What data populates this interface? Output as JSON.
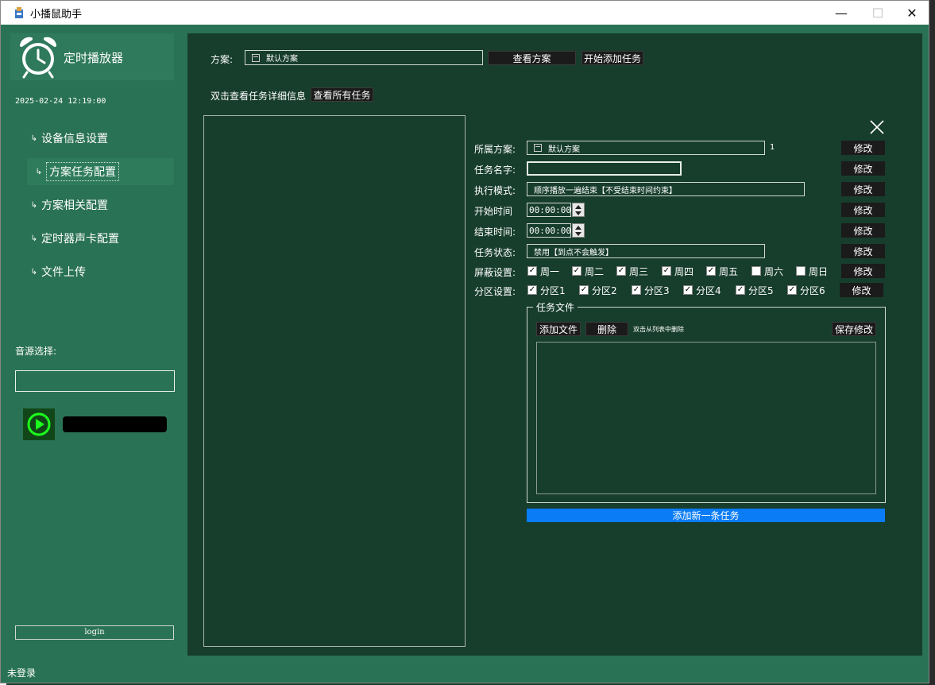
{
  "window": {
    "title": "小播鼠助手",
    "minimize": "—",
    "maximize": "☐",
    "close": "✕"
  },
  "sidebar": {
    "brand": "定时播放器",
    "datetime": "2025-02-24 12:19:00",
    "items": [
      {
        "label": "设备信息设置",
        "active": false
      },
      {
        "label": "方案任务配置",
        "active": true
      },
      {
        "label": "方案相关配置",
        "active": false
      },
      {
        "label": "定时器声卡配置",
        "active": false
      },
      {
        "label": "文件上传",
        "active": false
      }
    ],
    "audio_label": "音源选择:",
    "login": "login"
  },
  "status": "未登录",
  "header": {
    "plan_label": "方案:",
    "plan_value": "默认方案",
    "view_plan": "查看方案",
    "start_add": "开始添加任务",
    "hint": "双击查看任务详细信息",
    "view_all": "查看所有任务"
  },
  "detail": {
    "modify": "修改",
    "plan_label": "所属方案:",
    "plan_value": "默认方案",
    "plan_index": "1",
    "name_label": "任务名字:",
    "name_value": "",
    "mode_label": "执行模式:",
    "mode_value": "顺序播放一遍结束【不受结束时间约束】",
    "start_label": "开始时间",
    "start_value": "00:00:00",
    "end_label": "结束时间:",
    "end_value": "00:00:00",
    "state_label": "任务状态:",
    "state_value": "禁用【到点不会触发】",
    "block_label": "屏蔽设置:",
    "weekdays": [
      {
        "label": "周一",
        "checked": true
      },
      {
        "label": "周二",
        "checked": true
      },
      {
        "label": "周三",
        "checked": true
      },
      {
        "label": "周四",
        "checked": true
      },
      {
        "label": "周五",
        "checked": true
      },
      {
        "label": "周六",
        "checked": false
      },
      {
        "label": "周日",
        "checked": false
      }
    ],
    "zone_label": "分区设置:",
    "zones": [
      {
        "label": "分区1",
        "checked": true
      },
      {
        "label": "分区2",
        "checked": true
      },
      {
        "label": "分区3",
        "checked": true
      },
      {
        "label": "分区4",
        "checked": true
      },
      {
        "label": "分区5",
        "checked": true
      },
      {
        "label": "分区6",
        "checked": true
      }
    ],
    "files_group": "任务文件",
    "add_file": "添加文件",
    "delete": "删除",
    "delete_hint": "双击从列表中删除",
    "save_modify": "保存修改",
    "add_new_task": "添加新一条任务"
  },
  "colors": {
    "sidebar_bg": "#2a7255",
    "main_bg": "#173d2d",
    "accent_blue": "#0a7cf5",
    "play_green": "#1cff1c"
  }
}
